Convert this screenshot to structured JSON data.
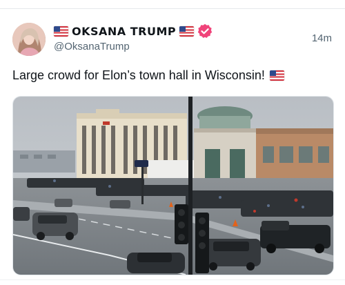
{
  "tweet": {
    "display_name": "OKЅANA TRUMP",
    "handle": "@OksanaTrump",
    "timestamp": "14m",
    "text": "Large crowd for Elon’s town hall in Wisconsin!",
    "verified_icon": "verified-badge-icon",
    "flag_icon": "us-flag-icon",
    "media_alt": "photo"
  },
  "colors": {
    "verified": "#f0447a",
    "text": "#0f1419",
    "secondary": "#536471"
  }
}
